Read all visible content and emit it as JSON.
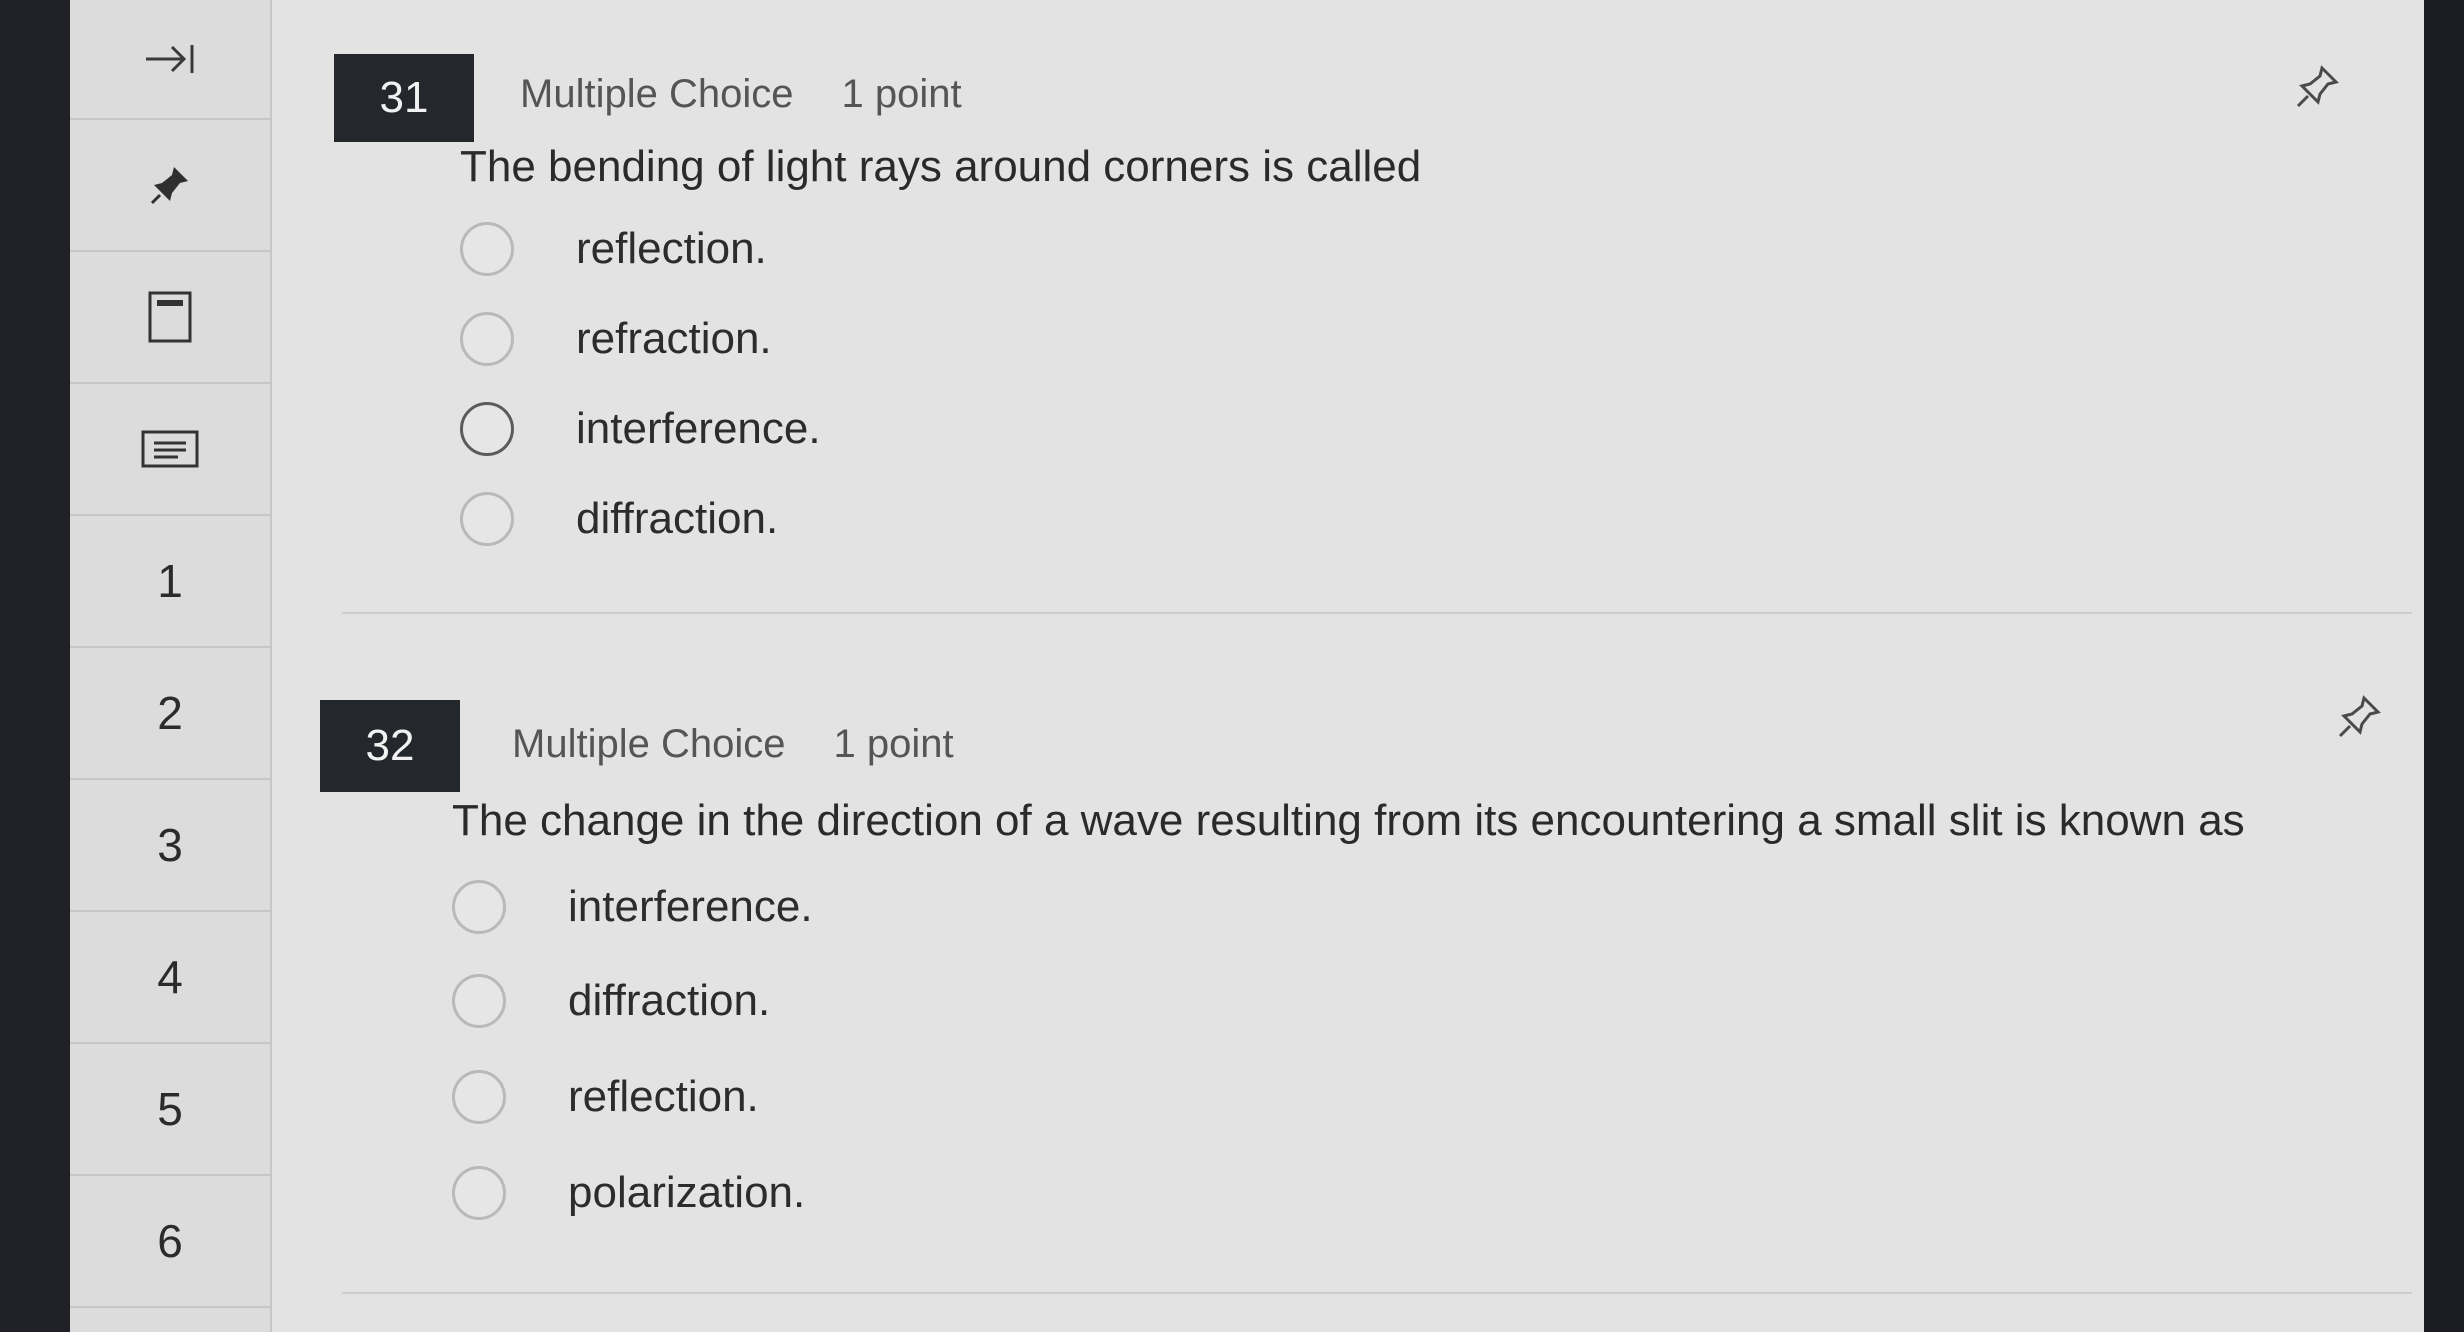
{
  "sidebar": {
    "collapse_icon": "collapse-right-icon",
    "pin_icon": "pin-icon",
    "calculator_icon": "calculator-icon",
    "notes_icon": "notes-icon",
    "items": [
      {
        "label": "1"
      },
      {
        "label": "2"
      },
      {
        "label": "3"
      },
      {
        "label": "4"
      },
      {
        "label": "5"
      },
      {
        "label": "6"
      }
    ]
  },
  "questions": [
    {
      "number": "31",
      "type": "Multiple Choice",
      "points": "1 point",
      "text": "The bending of light rays around corners is called",
      "options": [
        "reflection.",
        "refraction.",
        "interference.",
        "diffraction."
      ]
    },
    {
      "number": "32",
      "type": "Multiple Choice",
      "points": "1 point",
      "text": "The change in the direction of a wave resulting from its encountering a small slit is known as",
      "options": [
        "interference.",
        "diffraction.",
        "reflection.",
        "polarization."
      ]
    }
  ],
  "colors": {
    "badge_bg": "#24272c",
    "page_bg": "#e3e3e3",
    "sidebar_bg": "#dcdcdc"
  }
}
